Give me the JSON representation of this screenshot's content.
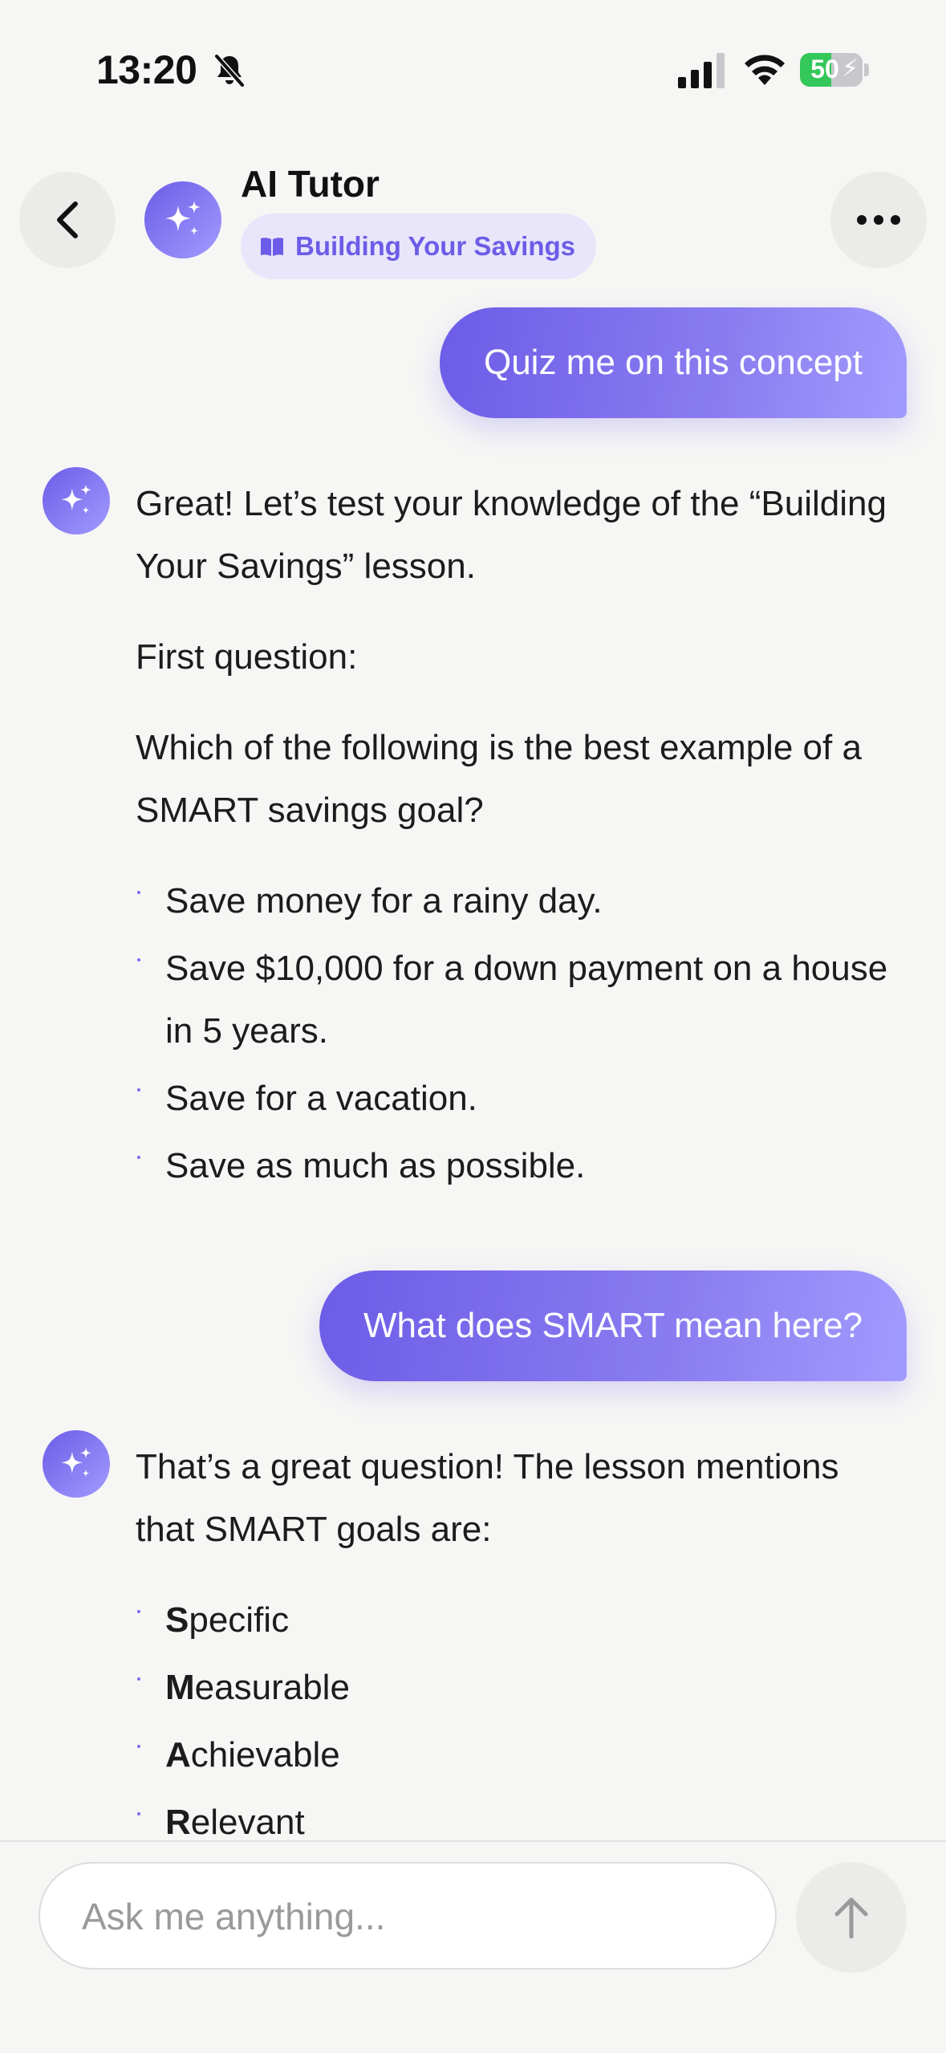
{
  "status_bar": {
    "time": "13:20",
    "battery_text": "50",
    "battery_level": 0.5
  },
  "header": {
    "title": "AI Tutor",
    "lesson_chip": "Building Your Savings"
  },
  "messages": {
    "user_1": "Quiz me on this concept",
    "ai_1": {
      "intro": "Great! Let’s test your knowledge of the “Building Your Savings” lesson.",
      "first_question_label": "First question:",
      "question": "Which of the following is the best example of a SMART savings goal?",
      "options": [
        "Save money for a rainy day.",
        "Save $10,000 for a down payment on a house in 5 years.",
        "Save for a vacation.",
        "Save as much as possible."
      ]
    },
    "user_2": "What does SMART mean here?",
    "ai_2": {
      "intro": "That’s a great question! The lesson mentions that SMART goals are:",
      "items": [
        {
          "letter": "S",
          "rest": "pecific"
        },
        {
          "letter": "M",
          "rest": "easurable"
        },
        {
          "letter": "A",
          "rest": "chievable"
        },
        {
          "letter": "R",
          "rest": "elevant"
        }
      ]
    }
  },
  "composer": {
    "placeholder": "Ask me anything..."
  },
  "colors": {
    "accent": "#6c5ce7",
    "accent_light": "#a29bfe",
    "chip_bg": "#e9e6fb"
  }
}
